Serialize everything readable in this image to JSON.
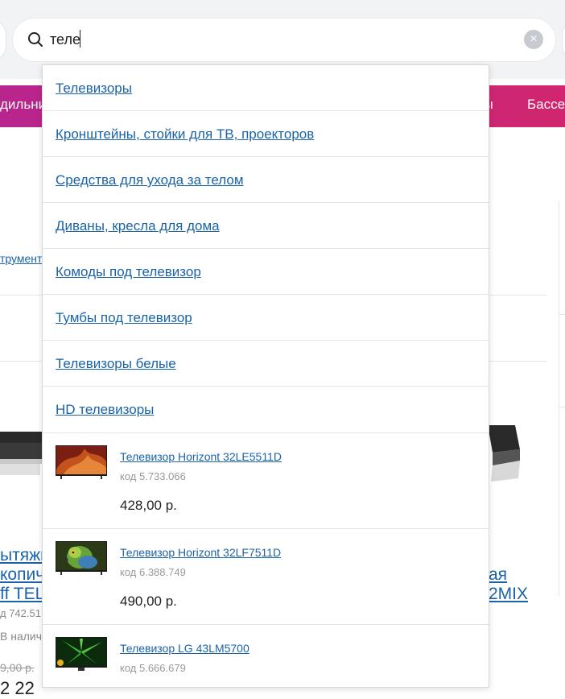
{
  "search": {
    "value": "теле"
  },
  "category_bar": {
    "left_fragment": "дильни",
    "right_fragment_1": "ры",
    "right_fragment_2": "Бассе"
  },
  "background": {
    "tools_link": "трумент",
    "left_product": {
      "title_lines": [
        "ытяжк",
        "копич",
        "ff TEL"
      ],
      "code": "д 742.51",
      "stock": "В налич",
      "old_price": "9,00 р.",
      "price": "2 22"
    },
    "right_product": {
      "title_lines": [
        "ая",
        "2MIX"
      ]
    }
  },
  "suggestions": [
    "Телевизоры",
    "Кронштейны, стойки для ТВ, проекторов",
    "Средства для ухода за телом",
    "Диваны, кресла для дома",
    "Комоды под телевизор",
    "Тумбы под телевизор",
    "Телевизоры белые",
    "HD телевизоры"
  ],
  "products": [
    {
      "name": "Телевизор Horizont 32LE5511D",
      "code": "код 5.733.066",
      "price": "428,00 р.",
      "thumb": "red-abstract"
    },
    {
      "name": "Телевизор Horizont 32LF7511D",
      "code": "код 6.388.749",
      "price": "490,00 р.",
      "thumb": "parrot"
    },
    {
      "name": "Телевизор LG 43LM5700",
      "code": "код 5.666.679",
      "price": "",
      "thumb": "green-leaves"
    }
  ],
  "colors": {
    "link": "#1a63a8",
    "category_bar_start": "#b8258d",
    "category_bar_end": "#d0266f"
  }
}
